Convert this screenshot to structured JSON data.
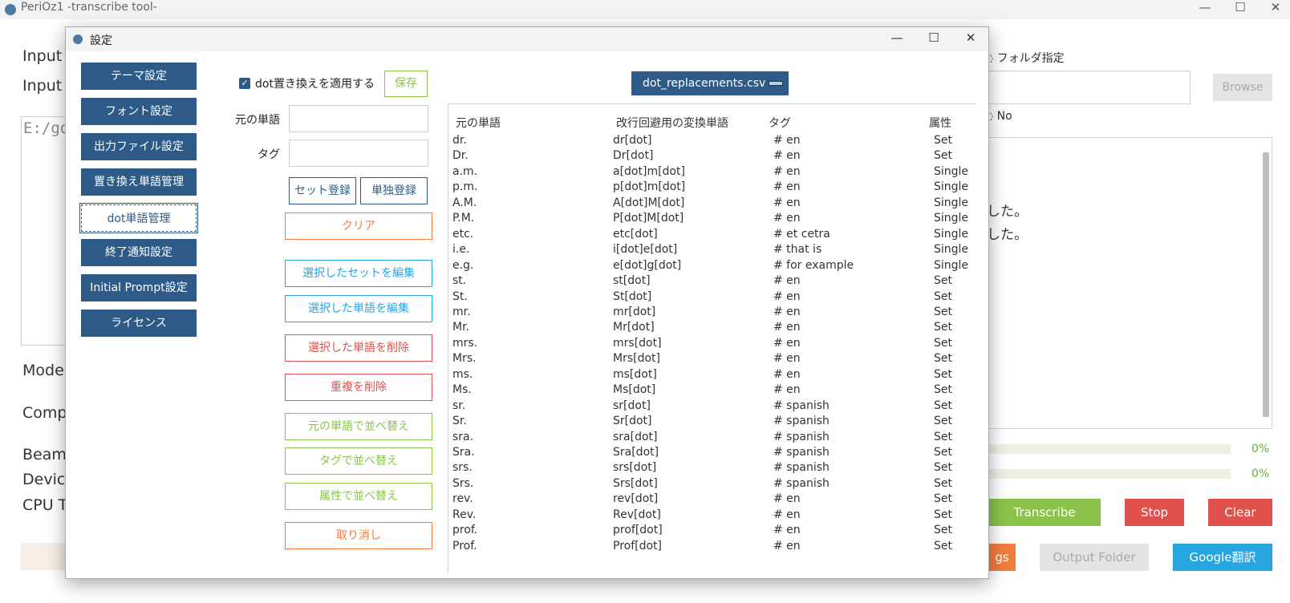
{
  "main_window": {
    "title": "PeriOz1 -transcribe tool-",
    "controls": [
      "—",
      "☐",
      "✕"
    ],
    "labels": {
      "input1": "Input",
      "input2": "Input",
      "model": "Mode",
      "compute": "Comp",
      "beam": "Beam",
      "device": "Devic",
      "cpu": "CPU T"
    },
    "textarea_text": "E:/go",
    "radio_folder": "フォルダ指定",
    "radio_no": "No",
    "browse_label": "Browse",
    "log_lines": [
      "した。",
      "した。"
    ],
    "progress": [
      {
        "value": 0,
        "label": "0%"
      },
      {
        "value": 0,
        "label": "0%"
      }
    ],
    "buttons": {
      "transcribe": "Transcribe",
      "stop": "Stop",
      "clear": "Clear",
      "settings_partial": "gs",
      "output_folder": "Output Folder",
      "google_translate": "Google翻訳"
    },
    "colors": {
      "green": "#8bc34a",
      "red": "#e0514c",
      "orange": "#f27d3b",
      "blue": "#27a5e0",
      "navy": "#2e5a87"
    }
  },
  "dialog": {
    "title": "設定",
    "controls": [
      "—",
      "☐",
      "✕"
    ],
    "nav": [
      {
        "label": "テーマ設定",
        "active": false
      },
      {
        "label": "フォント設定",
        "active": false
      },
      {
        "label": "出力ファイル設定",
        "active": false
      },
      {
        "label": "置き換え単語管理",
        "active": false
      },
      {
        "label": "dot単語管理",
        "active": true
      },
      {
        "label": "終了通知設定",
        "active": false
      },
      {
        "label": "Initial Prompt設定",
        "active": false
      },
      {
        "label": "ライセンス",
        "active": false
      }
    ],
    "form": {
      "apply_checkbox_label": "dot置き換えを適用する",
      "apply_checked": true,
      "save_label": "保存",
      "source_word_label": "元の単語",
      "source_word_value": "",
      "tag_label": "タグ",
      "tag_value": "",
      "set_register_label": "セット登録",
      "single_register_label": "単独登録",
      "clear_label": "クリア",
      "edit_set_label": "選択したセットを編集",
      "edit_word_label": "選択した単語を編集",
      "delete_word_label": "選択した単語を削除",
      "dedupe_label": "重複を削除",
      "sort_source_label": "元の単語で並べ替え",
      "sort_tag_label": "タグで並べ替え",
      "sort_attr_label": "属性で並べ替え",
      "undo_label": "取り消し"
    },
    "file_select": "dot_replacements.csv",
    "table": {
      "headers": [
        "元の単語",
        "改行回避用の変換単語",
        "タグ",
        "属性"
      ],
      "rows": [
        [
          "dr.",
          "dr[dot]",
          "# en",
          "Set"
        ],
        [
          "Dr.",
          "Dr[dot]",
          "# en",
          "Set"
        ],
        [
          "a.m.",
          "a[dot]m[dot]",
          "# en",
          "Single"
        ],
        [
          "p.m.",
          "p[dot]m[dot]",
          "# en",
          "Single"
        ],
        [
          "A.M.",
          "A[dot]M[dot]",
          "# en",
          "Single"
        ],
        [
          "P.M.",
          "P[dot]M[dot]",
          "# en",
          "Single"
        ],
        [
          "etc.",
          "etc[dot]",
          "# et cetra",
          "Single"
        ],
        [
          "i.e.",
          "i[dot]e[dot]",
          "# that is",
          "Single"
        ],
        [
          "e.g.",
          "e[dot]g[dot]",
          "# for example",
          "Single"
        ],
        [
          "st.",
          "st[dot]",
          "# en",
          "Set"
        ],
        [
          "St.",
          "St[dot]",
          "# en",
          "Set"
        ],
        [
          "mr.",
          "mr[dot]",
          "# en",
          "Set"
        ],
        [
          "Mr.",
          "Mr[dot]",
          "# en",
          "Set"
        ],
        [
          "mrs.",
          "mrs[dot]",
          "# en",
          "Set"
        ],
        [
          "Mrs.",
          "Mrs[dot]",
          "# en",
          "Set"
        ],
        [
          "ms.",
          "ms[dot]",
          "# en",
          "Set"
        ],
        [
          "Ms.",
          "Ms[dot]",
          "# en",
          "Set"
        ],
        [
          "sr.",
          "sr[dot]",
          "# spanish",
          "Set"
        ],
        [
          "Sr.",
          "Sr[dot]",
          "# spanish",
          "Set"
        ],
        [
          "sra.",
          "sra[dot]",
          "# spanish",
          "Set"
        ],
        [
          "Sra.",
          "Sra[dot]",
          "# spanish",
          "Set"
        ],
        [
          "srs.",
          "srs[dot]",
          "# spanish",
          "Set"
        ],
        [
          "Srs.",
          "Srs[dot]",
          "# spanish",
          "Set"
        ],
        [
          "rev.",
          "rev[dot]",
          "# en",
          "Set"
        ],
        [
          "Rev.",
          "Rev[dot]",
          "# en",
          "Set"
        ],
        [
          "prof.",
          "prof[dot]",
          "# en",
          "Set"
        ],
        [
          "Prof.",
          "Prof[dot]",
          "# en",
          "Set"
        ]
      ]
    }
  }
}
